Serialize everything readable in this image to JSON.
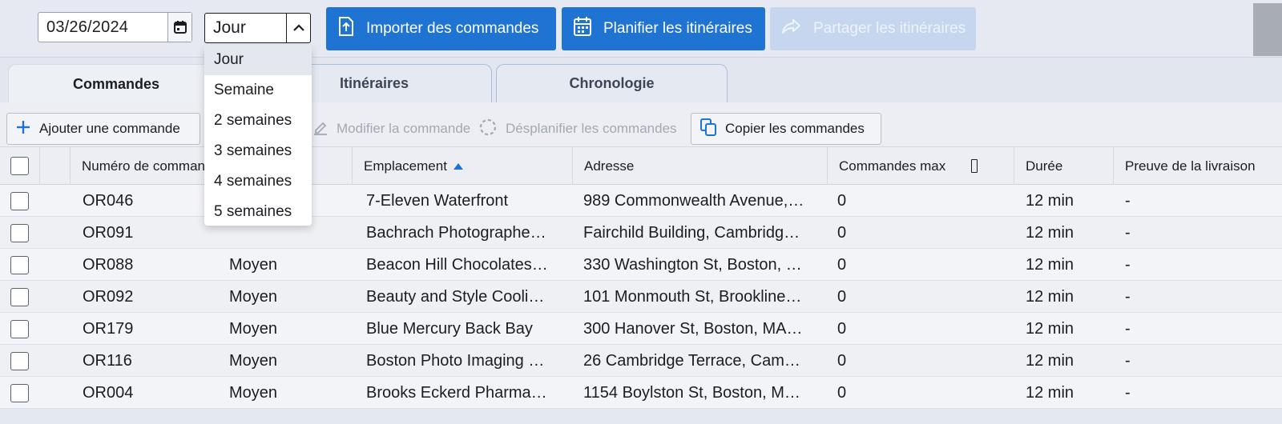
{
  "toolbar": {
    "date_value": "03/26/2024",
    "period_value": "Jour",
    "import_label": "Importer des commandes",
    "plan_label": "Planifier les itinéraires",
    "share_label": "Partager les itinéraires"
  },
  "tabs": [
    {
      "label": "Commandes",
      "active": true
    },
    {
      "label": "Itinéraires",
      "active": false
    },
    {
      "label": "Chronologie",
      "active": false
    }
  ],
  "actions": {
    "add_label": "Ajouter une commande",
    "edit_label": "Modifier la commande",
    "unplan_label": "Désplanifier les commandes",
    "copy_label": "Copier les commandes"
  },
  "columns": {
    "number": "Numéro de commande",
    "location": "Emplacement",
    "address": "Adresse",
    "max_orders": "Commandes max",
    "duration": "Durée",
    "proof": "Preuve de la livraison"
  },
  "rows": [
    {
      "number": "OR046",
      "size": "",
      "location": "7-Eleven Waterfront",
      "address": "989 Commonwealth Avenue,…",
      "max": "0",
      "duration": "12 min",
      "proof": "-"
    },
    {
      "number": "OR091",
      "size": "",
      "location": "Bachrach Photographe…",
      "address": "Fairchild Building, Cambridg…",
      "max": "0",
      "duration": "12 min",
      "proof": "-"
    },
    {
      "number": "OR088",
      "size": "Moyen",
      "location": "Beacon Hill Chocolates…",
      "address": "330 Washington St, Boston, …",
      "max": "0",
      "duration": "12 min",
      "proof": "-"
    },
    {
      "number": "OR092",
      "size": "Moyen",
      "location": "Beauty and Style Cooli…",
      "address": "101 Monmouth St, Brookline…",
      "max": "0",
      "duration": "12 min",
      "proof": "-"
    },
    {
      "number": "OR179",
      "size": "Moyen",
      "location": "Blue Mercury Back Bay",
      "address": "300 Hanover St, Boston, MA…",
      "max": "0",
      "duration": "12 min",
      "proof": "-"
    },
    {
      "number": "OR116",
      "size": "Moyen",
      "location": "Boston Photo Imaging …",
      "address": "26 Cambridge Terrace, Cam…",
      "max": "0",
      "duration": "12 min",
      "proof": "-"
    },
    {
      "number": "OR004",
      "size": "Moyen",
      "location": "Brooks Eckerd Pharma…",
      "address": "1154 Boylston St, Boston, M…",
      "max": "0",
      "duration": "12 min",
      "proof": "-"
    }
  ],
  "dropdown": {
    "options": [
      "Jour",
      "Semaine",
      "2 semaines",
      "3 semaines",
      "4 semaines",
      "5 semaines"
    ],
    "selected": "Jour"
  },
  "colors": {
    "primary": "#1f73d2",
    "primary_disabled": "#c5d6ee",
    "sort_arrow": "#1f73d2"
  }
}
